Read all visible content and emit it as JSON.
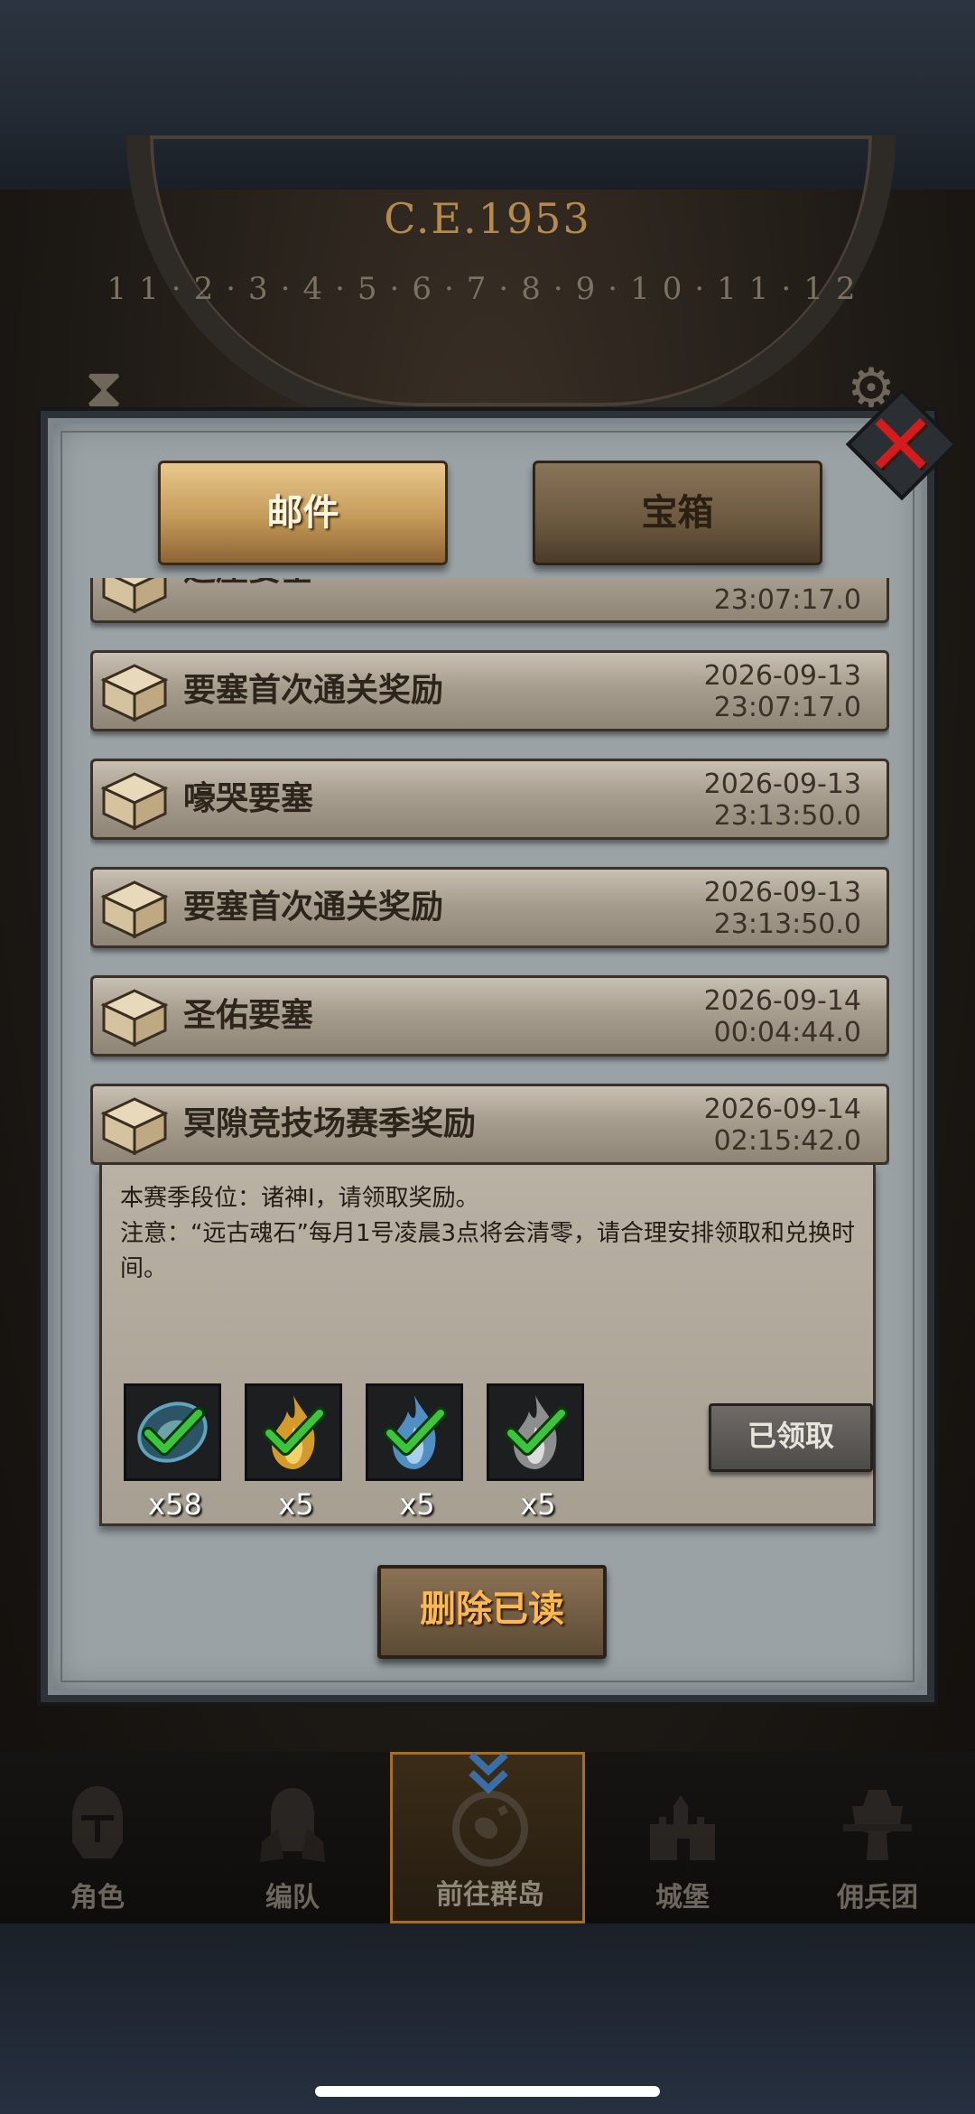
{
  "background": {
    "era": "C.E.1953",
    "clock_digits": "11·2·3·4·5·6·7·8·9·10·11·12"
  },
  "tabs": [
    {
      "label": "邮件",
      "active": true
    },
    {
      "label": "宝箱",
      "active": false
    }
  ],
  "mail_list": [
    {
      "title": "远崖要塞",
      "date": "",
      "time": "23:07:17.0"
    },
    {
      "title": "要塞首次通关奖励",
      "date": "2026-09-13",
      "time": "23:07:17.0"
    },
    {
      "title": "嚎哭要塞",
      "date": "2026-09-13",
      "time": "23:13:50.0"
    },
    {
      "title": "要塞首次通关奖励",
      "date": "2026-09-13",
      "time": "23:13:50.0"
    },
    {
      "title": "圣佑要塞",
      "date": "2026-09-14",
      "time": "00:04:44.0"
    },
    {
      "title": "冥隙竞技场赛季奖励",
      "date": "2026-09-14",
      "time": "02:15:42.0"
    }
  ],
  "detail": {
    "line1": "本赛季段位：诸神I，请领取奖励。",
    "line2": "注意：“远古魂石”每月1号凌晨3点将会清零，请合理安排领取和兑换时间。",
    "rewards": [
      {
        "icon": "soul-stone-icon",
        "count": "x58",
        "color": "#3f7f9a"
      },
      {
        "icon": "gold-flame-icon",
        "count": "x5",
        "color": "#d49a2a"
      },
      {
        "icon": "blue-flame-icon",
        "count": "x5",
        "color": "#4f8fc2"
      },
      {
        "icon": "silver-flame-icon",
        "count": "x5",
        "color": "#a9a9a9"
      }
    ],
    "claimed_label": "已领取"
  },
  "delete_read_label": "删除已读",
  "nav": [
    {
      "label": "角色",
      "icon": "knight-helmet-icon"
    },
    {
      "label": "编队",
      "icon": "formation-icon"
    },
    {
      "label": "前往群岛",
      "icon": "archipelago-compass-icon",
      "active": true
    },
    {
      "label": "城堡",
      "icon": "castle-icon"
    },
    {
      "label": "佣兵团",
      "icon": "mercenary-icon"
    }
  ],
  "colors": {
    "accent_orange": "#ffb950",
    "close_red": "#d41c1c",
    "check_green": "#3cc43c"
  }
}
